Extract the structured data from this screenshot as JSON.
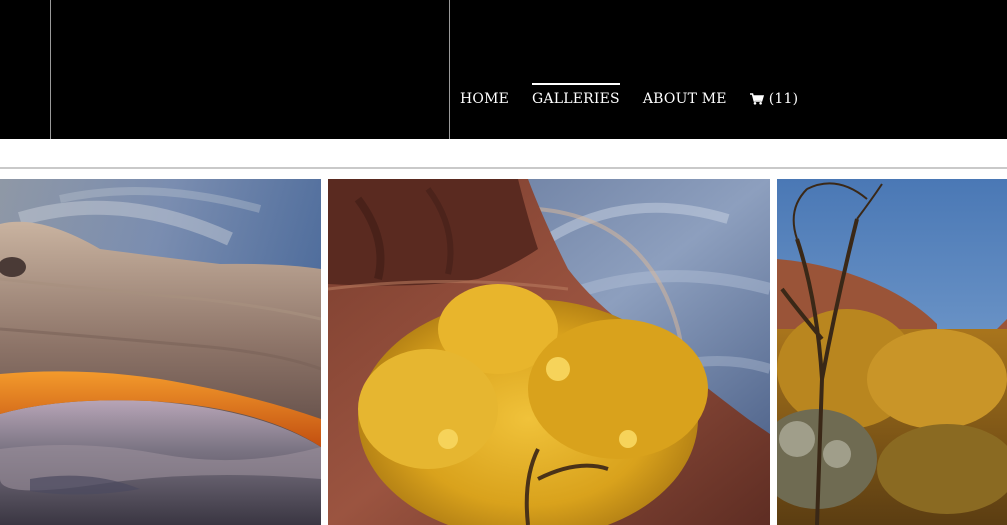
{
  "nav": {
    "items": [
      {
        "label": "HOME",
        "active": false
      },
      {
        "label": "GALLERIES",
        "active": true
      },
      {
        "label": "ABOUT ME",
        "active": false
      }
    ],
    "cart": {
      "icon": "shopping-cart-icon",
      "count_label": "(11)"
    }
  },
  "gallery": {
    "photos": [
      {
        "name": "mesa-arch-photo",
        "subject": "stone arch at sunrise over canyon"
      },
      {
        "name": "golden-cottonwood-photo",
        "subject": "yellow tree beneath red cliff with halo"
      },
      {
        "name": "autumn-canyon-photo",
        "subject": "autumn trees in canyon"
      }
    ]
  },
  "colors": {
    "header_bg": "#000000",
    "nav_text": "#ffffff",
    "divider": "#c9c9c9"
  }
}
